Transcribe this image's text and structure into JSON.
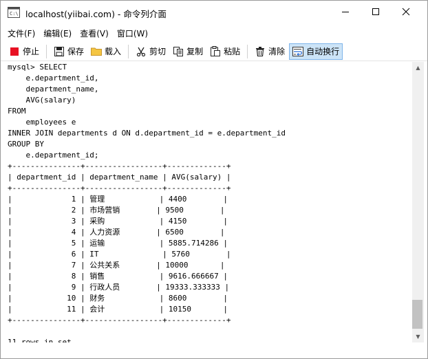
{
  "window": {
    "title": "localhost(yiibai.com) - 命令列介面"
  },
  "menu": [
    {
      "label": "文件(F)"
    },
    {
      "label": "编辑(E)"
    },
    {
      "label": "查看(V)"
    },
    {
      "label": "窗口(W)"
    }
  ],
  "toolbar": {
    "stop": "停止",
    "save": "保存",
    "load": "载入",
    "cut": "剪切",
    "copy": "复制",
    "paste": "粘贴",
    "clear": "清除",
    "wrap": "自动换行"
  },
  "console": {
    "lines": [
      "mysql> SELECT",
      "    e.department_id,",
      "    department_name,",
      "    AVG(salary)",
      "FROM",
      "    employees e",
      "INNER JOIN departments d ON d.department_id = e.department_id",
      "GROUP BY",
      "    e.department_id;",
      "+---------------+-----------------+-------------+",
      "| department_id | department_name | AVG(salary) |",
      "+---------------+-----------------+-------------+",
      "|             1 | 管理            | 4400        |",
      "|             2 | 市场营销        | 9500        |",
      "|             3 | 采购            | 4150        |",
      "|             4 | 人力资源        | 6500        |",
      "|             5 | 运输            | 5885.714286 |",
      "|             6 | IT              | 5760        |",
      "|             7 | 公共关系        | 10000       |",
      "|             8 | 销售            | 9616.666667 |",
      "|             9 | 行政人员        | 19333.333333 |",
      "|            10 | 财务            | 8600        |",
      "|            11 | 会计            | 10150       |",
      "+---------------+-----------------+-------------+",
      "",
      "11 rows in set"
    ]
  },
  "colors": {
    "stop_icon": "#e81123",
    "wrap_active_bg": "#cce4f7",
    "scroll_thumb": "#c2c2c2"
  }
}
